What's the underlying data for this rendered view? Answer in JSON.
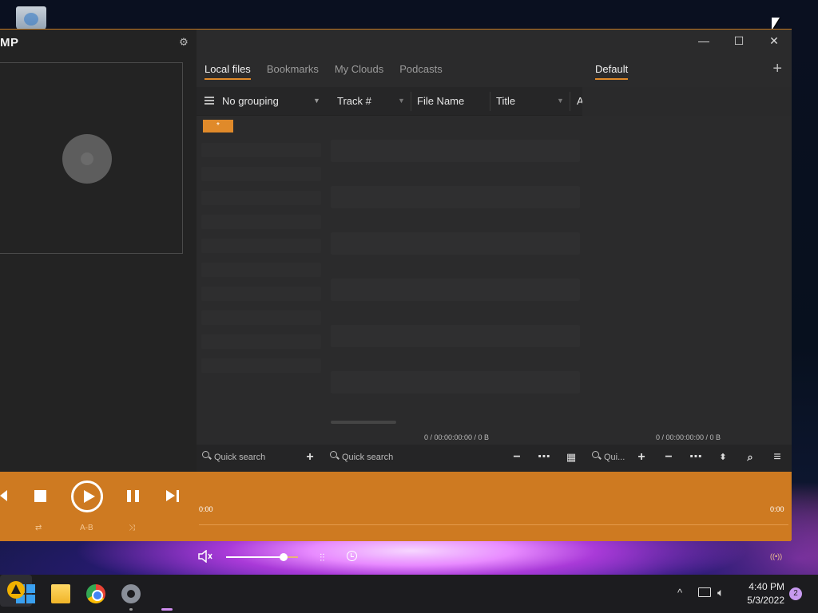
{
  "app": {
    "logo_text": "MP"
  },
  "window": {
    "minimize": "—",
    "maximize": "☐",
    "close": "✕"
  },
  "tabs": [
    {
      "label": "Local files",
      "active": true
    },
    {
      "label": "Bookmarks",
      "active": false
    },
    {
      "label": "My Clouds",
      "active": false
    },
    {
      "label": "Podcasts",
      "active": false
    }
  ],
  "playlist": {
    "tab_label": "Default",
    "add_label": "+"
  },
  "columns": {
    "grouping": "No grouping",
    "track": "Track #",
    "filename": "File Name",
    "title": "Title",
    "artist_cut": "A"
  },
  "group_badge": "*",
  "status": {
    "left": "0 / 00:00:00:00 / 0 B",
    "right": "0 / 00:00:00:00 / 0 B"
  },
  "search": {
    "left_placeholder": "Quick search",
    "mid_placeholder": "Quick search",
    "right_placeholder": "Qui..."
  },
  "player": {
    "time_elapsed": "0:00",
    "time_total": "0:00",
    "ab_label": "A-B",
    "volume_fraction": 0.8
  },
  "taskbar": {
    "time": "4:40 PM",
    "date": "5/3/2022",
    "notification_count": "2"
  },
  "colors": {
    "accent": "#ce7a21",
    "tab_underline": "#e08a2a",
    "bg_dark": "#2a2a2b"
  }
}
